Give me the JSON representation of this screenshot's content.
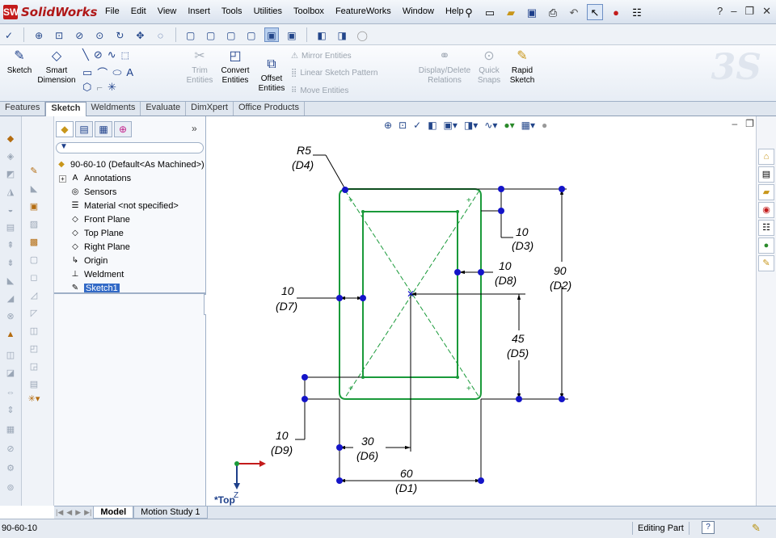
{
  "app": {
    "name": "SolidWorks",
    "logo_mark": "SW"
  },
  "menu": [
    "File",
    "Edit",
    "View",
    "Insert",
    "Tools",
    "Utilities",
    "Toolbox",
    "FeatureWorks",
    "Window",
    "Help"
  ],
  "quick_icons": [
    "pin-icon",
    "new-icon",
    "open-icon",
    "save-icon",
    "print-icon",
    "undo-icon",
    "select-icon",
    "rebuild-icon",
    "options-icon",
    "help-icon"
  ],
  "window_controls": [
    "?",
    "–",
    "❐",
    "✕"
  ],
  "command_manager": {
    "sketch": "Sketch",
    "smart_dimension": [
      "Smart",
      "Dimension"
    ],
    "trim": [
      "Trim",
      "Entities"
    ],
    "convert": [
      "Convert",
      "Entities"
    ],
    "offset": [
      "Offset",
      "Entities"
    ],
    "mirror": "Mirror Entities",
    "linear_pattern": "Linear Sketch Pattern",
    "move": "Move Entities",
    "display_delete": [
      "Display/Delete",
      "Relations"
    ],
    "quick_snaps": [
      "Quick",
      "Snaps"
    ],
    "rapid_sketch": [
      "Rapid",
      "Sketch"
    ],
    "brand_watermark": "3S"
  },
  "command_tabs": [
    {
      "label": "Features",
      "active": false
    },
    {
      "label": "Sketch",
      "active": true
    },
    {
      "label": "Weldments",
      "active": false
    },
    {
      "label": "Evaluate",
      "active": false
    },
    {
      "label": "DimXpert",
      "active": false
    },
    {
      "label": "Office Products",
      "active": false
    }
  ],
  "feature_tree": {
    "more": "»",
    "root": "90-60-10  (Default<As Machined>)",
    "items": [
      {
        "label": "Annotations",
        "icon": "annotations-icon",
        "glyph": "A",
        "expandable": true
      },
      {
        "label": "Sensors",
        "icon": "sensors-icon",
        "glyph": "◎",
        "expandable": false
      },
      {
        "label": "Material <not specified>",
        "icon": "material-icon",
        "glyph": "☰",
        "expandable": false
      },
      {
        "label": "Front Plane",
        "icon": "plane-icon",
        "glyph": "◇",
        "expandable": false
      },
      {
        "label": "Top Plane",
        "icon": "plane-icon",
        "glyph": "◇",
        "expandable": false
      },
      {
        "label": "Right Plane",
        "icon": "plane-icon",
        "glyph": "◇",
        "expandable": false
      },
      {
        "label": "Origin",
        "icon": "origin-icon",
        "glyph": "↳",
        "expandable": false
      },
      {
        "label": "Weldment",
        "icon": "weldment-icon",
        "glyph": "⊥",
        "expandable": false
      },
      {
        "label": "Sketch1",
        "icon": "sketch-icon",
        "glyph": "✎",
        "expandable": false,
        "selected": true
      }
    ]
  },
  "sketch": {
    "view_label": "*Top",
    "axis_z": "Z",
    "dimensions": {
      "r5": {
        "value": "R5",
        "name": "(D4)"
      },
      "d3": {
        "value": "10",
        "name": "(D3)"
      },
      "d8": {
        "value": "10",
        "name": "(D8)"
      },
      "d2": {
        "value": "90",
        "name": "(D2)"
      },
      "d7": {
        "value": "10",
        "name": "(D7)"
      },
      "d5": {
        "value": "45",
        "name": "(D5)"
      },
      "d9": {
        "value": "10",
        "name": "(D9)"
      },
      "d6": {
        "value": "30",
        "name": "(D6)"
      },
      "d1": {
        "value": "60",
        "name": "(D1)"
      }
    },
    "colors": {
      "geometry": "#1a9a3a",
      "dimension": "#000000",
      "points": "#1414c8",
      "centerline": "#1a9a3a"
    }
  },
  "bottom_tabs": [
    {
      "label": "Model",
      "active": true
    },
    {
      "label": "Motion Study 1",
      "active": false
    }
  ],
  "status": {
    "document": "90-60-10",
    "mode": "Editing Part",
    "help": "?"
  }
}
